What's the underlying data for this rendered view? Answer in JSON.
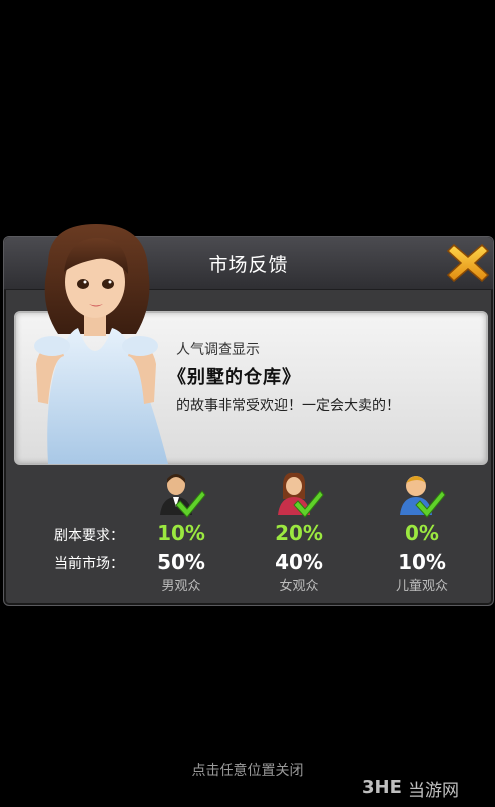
{
  "dialog": {
    "title": "市场反馈",
    "close_icon": "close-x-icon",
    "accent_color": "#f5a623"
  },
  "message": {
    "line1": "人气调查显示",
    "line2": "《别墅的仓库》",
    "line3": "的故事非常受欢迎！一定会大卖的！"
  },
  "stats": {
    "row_labels": {
      "requirement": "剧本要求：",
      "market": "当前市场："
    },
    "audiences": [
      {
        "label": "男观众",
        "requirement": "10%",
        "market": "50%",
        "icon": "male-audience-icon"
      },
      {
        "label": "女观众",
        "requirement": "20%",
        "market": "40%",
        "icon": "female-audience-icon"
      },
      {
        "label": "儿童观众",
        "requirement": "0%",
        "market": "10%",
        "icon": "child-audience-icon"
      }
    ],
    "requirement_color": "#9be840"
  },
  "footer": {
    "hint": "点击任意位置关闭"
  },
  "watermark": {
    "text": "当游网",
    "logo_text": "3HE"
  }
}
